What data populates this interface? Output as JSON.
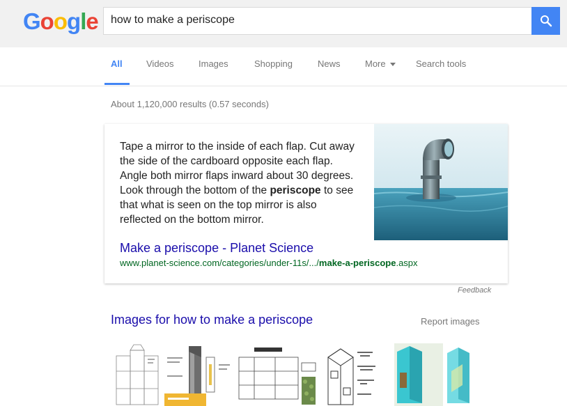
{
  "header": {
    "logo_letters": [
      {
        "char": "G",
        "color": "#4285f4"
      },
      {
        "char": "o",
        "color": "#ea4335"
      },
      {
        "char": "o",
        "color": "#fbbc05"
      },
      {
        "char": "g",
        "color": "#4285f4"
      },
      {
        "char": "l",
        "color": "#34a853"
      },
      {
        "char": "e",
        "color": "#ea4335"
      }
    ],
    "search_query": "how to make a periscope",
    "search_button_icon": "search-icon",
    "accent_color": "#4285f4"
  },
  "tabs": [
    {
      "label": "All",
      "active": true
    },
    {
      "label": "Videos",
      "active": false
    },
    {
      "label": "Images",
      "active": false
    },
    {
      "label": "Shopping",
      "active": false
    },
    {
      "label": "News",
      "active": false
    },
    {
      "label": "More",
      "active": false,
      "icon": "caret-down-icon"
    },
    {
      "label": "Search tools",
      "active": false
    }
  ],
  "stats": "About 1,120,000 results (0.57 seconds)",
  "featured_snippet": {
    "text_before": "Tape a mirror to the inside of each flap. Cut away the side of the cardboard opposite each flap. Angle both mirror flaps inward about 30 degrees. Look through the bottom of the ",
    "text_bold": "periscope",
    "text_after": " to see that what is seen on the top mirror is also reflected on the bottom mirror.",
    "image_icon": "periscope-photo",
    "result_title": "Make a periscope - Planet Science",
    "url_prefix": "www.planet-science.com/categories/under-11s/.../",
    "url_bold": "make-a-periscope",
    "url_suffix": ".aspx",
    "feedback_label": "Feedback"
  },
  "images_section": {
    "heading": "Images for how to make a periscope",
    "report_label": "Report images",
    "thumbnails": [
      "periscope-template-thumbnail",
      "periscope-diagram-thumbnail",
      "periscope-plan-thumbnail",
      "periscope-milk-carton-thumbnail",
      "periscope-3d-model-thumbnail"
    ]
  }
}
